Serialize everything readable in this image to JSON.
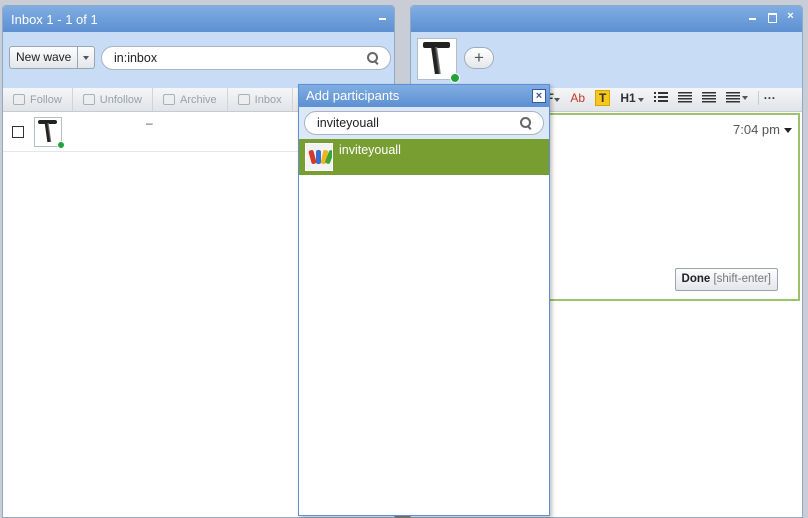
{
  "inbox": {
    "title": "Inbox 1 - 1 of 1",
    "new_wave_label": "New wave",
    "search_value": "in:inbox",
    "actions": [
      "Follow",
      "Unfollow",
      "Archive",
      "Inbox"
    ],
    "rows": [
      {
        "snippet": "–"
      }
    ]
  },
  "wave": {
    "formatting": {
      "italic_sample": "F",
      "text_color_label": "Ab",
      "highlight_label": "T",
      "heading_label": "H1",
      "more_label": "···"
    },
    "blip": {
      "time": "7:04 pm",
      "done_label": "Done",
      "done_shortcut": "[shift-enter]"
    }
  },
  "add_participants": {
    "title": "Add participants",
    "close_label": "×",
    "search_value": "inviteyouall",
    "results": [
      {
        "name": "inviteyouall"
      }
    ]
  },
  "colors": {
    "titlebar": "#5d8fd2",
    "header_area": "#c8dcf5",
    "selected_result": "#789e32",
    "editor_border": "#9cc36a",
    "online": "#22a33a"
  }
}
